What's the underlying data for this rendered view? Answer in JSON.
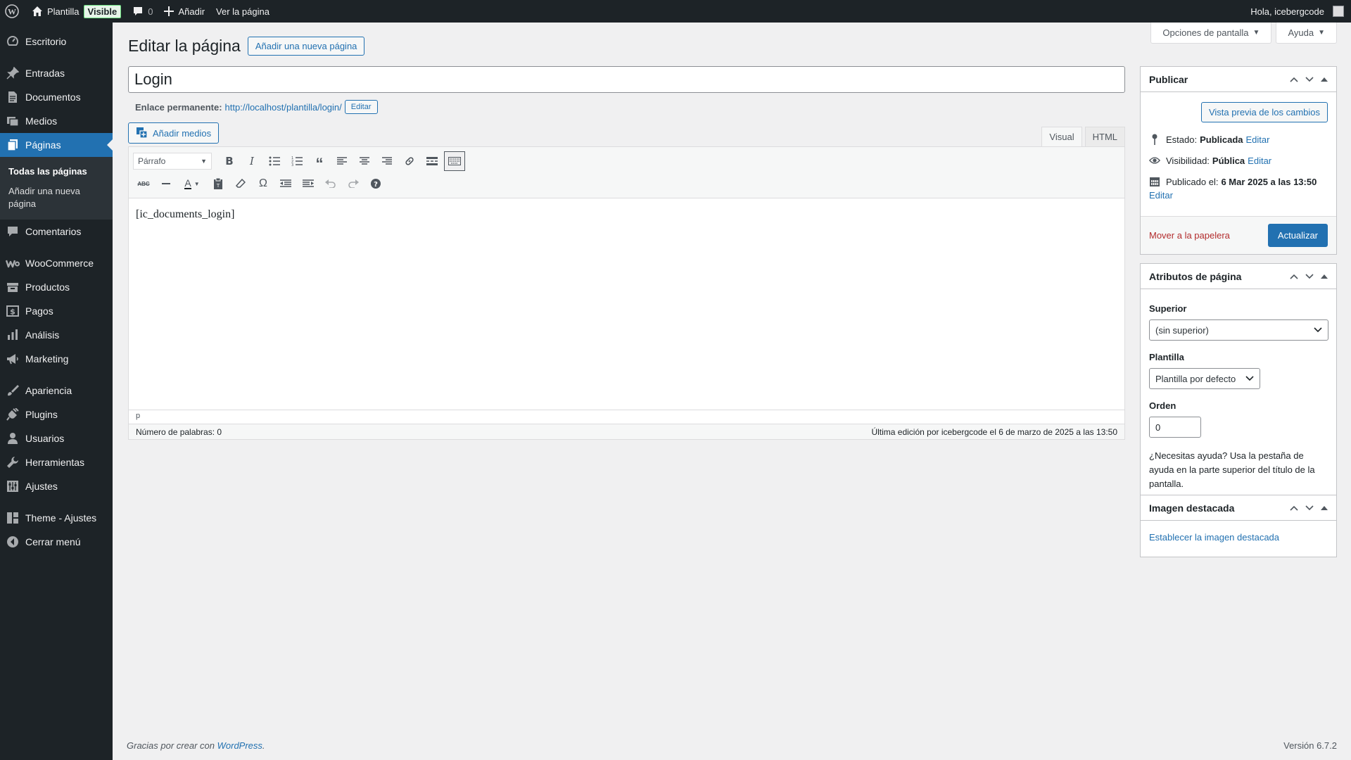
{
  "adminbar": {
    "site_name": "Plantilla",
    "visible_badge": "Visible",
    "comments_count": "0",
    "add_new": "Añadir",
    "view_page": "Ver la página",
    "greeting": "Hola, icebergcode"
  },
  "sidebar": {
    "items": [
      {
        "label": "Escritorio",
        "icon": "dashboard-icon"
      },
      {
        "label": "Entradas",
        "icon": "pin-icon"
      },
      {
        "label": "Documentos",
        "icon": "document-icon"
      },
      {
        "label": "Medios",
        "icon": "media-icon"
      },
      {
        "label": "Páginas",
        "icon": "pages-icon"
      },
      {
        "label": "Comentarios",
        "icon": "comment-icon"
      },
      {
        "label": "WooCommerce",
        "icon": "woo-icon"
      },
      {
        "label": "Productos",
        "icon": "archive-icon"
      },
      {
        "label": "Pagos",
        "icon": "payment-icon"
      },
      {
        "label": "Análisis",
        "icon": "bar-chart-icon"
      },
      {
        "label": "Marketing",
        "icon": "megaphone-icon"
      },
      {
        "label": "Apariencia",
        "icon": "brush-icon"
      },
      {
        "label": "Plugins",
        "icon": "plug-icon"
      },
      {
        "label": "Usuarios",
        "icon": "user-icon"
      },
      {
        "label": "Herramientas",
        "icon": "wrench-icon"
      },
      {
        "label": "Ajustes",
        "icon": "sliders-icon"
      },
      {
        "label": "Theme - Ajustes",
        "icon": "grid-icon"
      },
      {
        "label": "Cerrar menú",
        "icon": "collapse-icon"
      }
    ],
    "submenu": {
      "all_pages": "Todas las páginas",
      "add_new": "Añadir una nueva página"
    }
  },
  "screen_meta": {
    "options": "Opciones de pantalla",
    "help": "Ayuda"
  },
  "page": {
    "title": "Editar la página",
    "add_new_button": "Añadir una nueva página",
    "post_title": "Login",
    "permalink_label": "Enlace permanente:",
    "permalink_url": "http://localhost/plantilla/login/",
    "permalink_edit": "Editar",
    "add_media": "Añadir medios"
  },
  "editor": {
    "tab_visual": "Visual",
    "tab_html": "HTML",
    "format_select": "Párrafo",
    "content": "[ic_documents_login]",
    "path": "p",
    "word_count": "Número de palabras: 0",
    "last_edit": "Última edición por icebergcode el 6 de marzo de 2025 a las 13:50"
  },
  "publish_box": {
    "title": "Publicar",
    "preview_button": "Vista previa de los cambios",
    "status_label": "Estado:",
    "status_value": "Publicada",
    "status_edit": "Editar",
    "visibility_label": "Visibilidad:",
    "visibility_value": "Pública",
    "visibility_edit": "Editar",
    "published_label": "Publicado el:",
    "published_value": "6 Mar 2025 a las 13:50",
    "published_edit": "Editar",
    "trash_link": "Mover a la papelera",
    "update_button": "Actualizar"
  },
  "attributes_box": {
    "title": "Atributos de página",
    "parent_label": "Superior",
    "parent_value": "(sin superior)",
    "template_label": "Plantilla",
    "template_value": "Plantilla por defecto",
    "order_label": "Orden",
    "order_value": "0",
    "help_text": "¿Necesitas ayuda? Usa la pestaña de ayuda en la parte superior del título de la pantalla."
  },
  "featured_box": {
    "title": "Imagen destacada",
    "set_link": "Establecer la imagen destacada"
  },
  "footer": {
    "thanks_prefix": "Gracias por crear con",
    "thanks_link": "WordPress",
    "thanks_suffix": ".",
    "version": "Versión 6.7.2"
  },
  "colors": {
    "admin_dark": "#1d2327",
    "accent": "#2271b1",
    "trash": "#b32d2e"
  }
}
